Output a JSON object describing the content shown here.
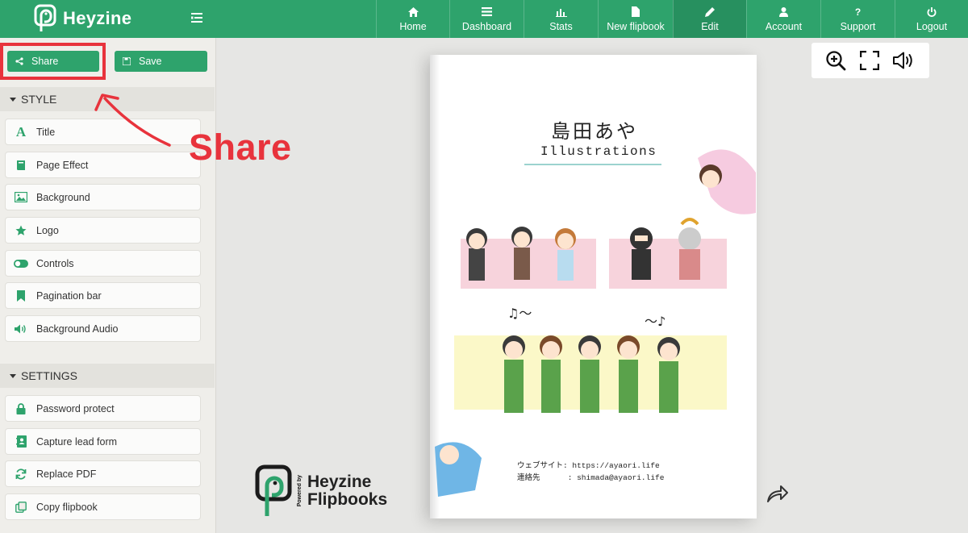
{
  "app": {
    "name": "Heyzine"
  },
  "nav": [
    {
      "label": "Home",
      "icon": "home-icon"
    },
    {
      "label": "Dashboard",
      "icon": "list-icon"
    },
    {
      "label": "Stats",
      "icon": "bar-chart-icon"
    },
    {
      "label": "New flipbook",
      "icon": "file-icon"
    },
    {
      "label": "Edit",
      "icon": "pencil-icon",
      "active": true
    },
    {
      "label": "Account",
      "icon": "user-icon"
    },
    {
      "label": "Support",
      "icon": "question-icon"
    },
    {
      "label": "Logout",
      "icon": "power-icon"
    }
  ],
  "sidebar": {
    "share_label": "Share",
    "save_label": "Save",
    "style_header": "STYLE",
    "style_items": [
      {
        "label": "Title",
        "icon": "title-font-icon"
      },
      {
        "label": "Page Effect",
        "icon": "book-icon"
      },
      {
        "label": "Background",
        "icon": "image-icon"
      },
      {
        "label": "Logo",
        "icon": "star-icon"
      },
      {
        "label": "Controls",
        "icon": "toggle-icon"
      },
      {
        "label": "Pagination bar",
        "icon": "bookmark-icon"
      },
      {
        "label": "Background Audio",
        "icon": "speaker-icon"
      }
    ],
    "settings_header": "SETTINGS",
    "settings_items": [
      {
        "label": "Password protect",
        "icon": "lock-icon"
      },
      {
        "label": "Capture lead form",
        "icon": "contact-book-icon"
      },
      {
        "label": "Replace PDF",
        "icon": "sync-icon"
      },
      {
        "label": "Copy flipbook",
        "icon": "copy-icon"
      }
    ]
  },
  "annotation": {
    "text": "Share"
  },
  "viewer": {
    "tools": [
      "zoom-in-icon",
      "fullscreen-icon",
      "volume-icon"
    ],
    "page": {
      "title": "島田あや",
      "subtitle": "Illustrations",
      "website_line": "ウェブサイト: https://ayaori.life",
      "contact_line": "連絡先      : shimada@ayaori.life"
    },
    "brand": {
      "powered": "Powered by",
      "line1": "Heyzine",
      "line2": "Flipbooks"
    }
  },
  "colors": {
    "accent": "#2ea36c",
    "annotation": "#e8333c"
  }
}
